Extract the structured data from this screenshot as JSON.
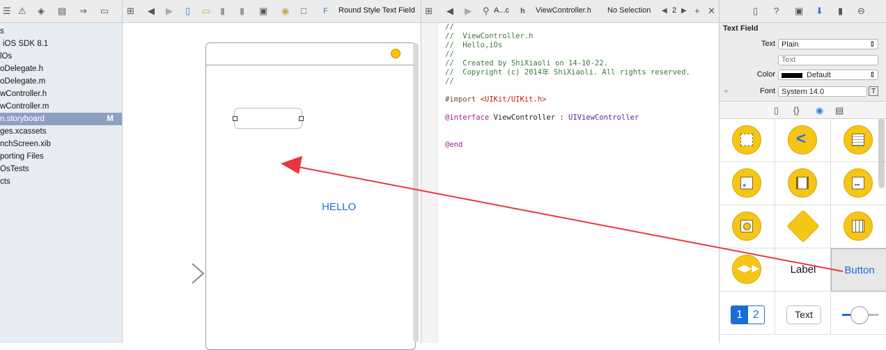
{
  "navigator": {
    "items": [
      {
        "label": "s",
        "indent": 0
      },
      {
        "label": "iOS SDK 8.1",
        "indent": 1
      },
      {
        "label": "lOs",
        "indent": 0
      },
      {
        "label": "oDelegate.h",
        "indent": 0
      },
      {
        "label": "oDelegate.m",
        "indent": 0
      },
      {
        "label": "wController.h",
        "indent": 0
      },
      {
        "label": "wController.m",
        "indent": 0
      },
      {
        "label": "n.storyboard",
        "indent": 0,
        "badge": "M"
      },
      {
        "label": "ges.xcassets",
        "indent": 0
      },
      {
        "label": "nchScreen.xib",
        "indent": 0
      },
      {
        "label": "porting Files",
        "indent": 0
      },
      {
        "label": "OsTests",
        "indent": 0
      },
      {
        "label": "cts",
        "indent": 0
      }
    ]
  },
  "storyboard": {
    "jumpbar_item": "Round Style Text Field",
    "label_text": "HELLO"
  },
  "editor": {
    "jumpbar": {
      "file_short": "A...c",
      "file": "ViewController.h",
      "selection": "No Selection",
      "counter": "2"
    },
    "lines": [
      {
        "t": "//",
        "c": "cmt"
      },
      {
        "t": "//  ViewController.h",
        "c": "cmt"
      },
      {
        "t": "//  Hello,iOs",
        "c": "cmt"
      },
      {
        "t": "//",
        "c": "cmt"
      },
      {
        "t": "//  Created by ShiXiaoli on 14-10-22.",
        "c": "cmt"
      },
      {
        "t": "//  Copyright (c) 2014年 ShiXiaoli. All rights reserved.",
        "c": "cmt"
      },
      {
        "t": "//",
        "c": "cmt"
      },
      {
        "t": "",
        "c": ""
      },
      {
        "t": "#import ",
        "c": "pre",
        "t2": "<UIKit/UIKit.h>",
        "c2": "str"
      },
      {
        "t": "",
        "c": ""
      },
      {
        "t": "@interface",
        "c": "kw",
        "t2": " ViewController : ",
        "c2": "",
        "t3": "UIViewController",
        "c3": "cls"
      },
      {
        "t": "",
        "c": ""
      },
      {
        "t": "",
        "c": ""
      },
      {
        "t": "@end",
        "c": "kw"
      }
    ]
  },
  "inspector": {
    "section_title": "Text Field",
    "text_label": "Text",
    "text_value": "Plain",
    "text_placeholder": "Text",
    "color_label": "Color",
    "color_value": "Default",
    "font_label": "Font",
    "font_value": "System 14.0",
    "library": {
      "label_cell": "Label",
      "button_cell": "Button",
      "seg_1": "1",
      "seg_2": "2",
      "text_cell": "Text"
    }
  },
  "colors": {
    "accent": "#1a6ed8",
    "arrow": "#e8363c",
    "object_icon": "#f5c518"
  }
}
